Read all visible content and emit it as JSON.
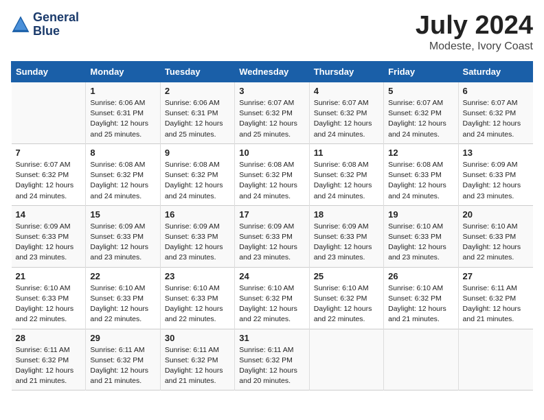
{
  "header": {
    "logo_line1": "General",
    "logo_line2": "Blue",
    "main_title": "July 2024",
    "subtitle": "Modeste, Ivory Coast"
  },
  "days_of_week": [
    "Sunday",
    "Monday",
    "Tuesday",
    "Wednesday",
    "Thursday",
    "Friday",
    "Saturday"
  ],
  "weeks": [
    [
      {
        "day": "",
        "sunrise": "",
        "sunset": "",
        "daylight": ""
      },
      {
        "day": "1",
        "sunrise": "Sunrise: 6:06 AM",
        "sunset": "Sunset: 6:31 PM",
        "daylight": "Daylight: 12 hours and 25 minutes."
      },
      {
        "day": "2",
        "sunrise": "Sunrise: 6:06 AM",
        "sunset": "Sunset: 6:31 PM",
        "daylight": "Daylight: 12 hours and 25 minutes."
      },
      {
        "day": "3",
        "sunrise": "Sunrise: 6:07 AM",
        "sunset": "Sunset: 6:32 PM",
        "daylight": "Daylight: 12 hours and 25 minutes."
      },
      {
        "day": "4",
        "sunrise": "Sunrise: 6:07 AM",
        "sunset": "Sunset: 6:32 PM",
        "daylight": "Daylight: 12 hours and 24 minutes."
      },
      {
        "day": "5",
        "sunrise": "Sunrise: 6:07 AM",
        "sunset": "Sunset: 6:32 PM",
        "daylight": "Daylight: 12 hours and 24 minutes."
      },
      {
        "day": "6",
        "sunrise": "Sunrise: 6:07 AM",
        "sunset": "Sunset: 6:32 PM",
        "daylight": "Daylight: 12 hours and 24 minutes."
      }
    ],
    [
      {
        "day": "7",
        "sunrise": "Sunrise: 6:07 AM",
        "sunset": "Sunset: 6:32 PM",
        "daylight": "Daylight: 12 hours and 24 minutes."
      },
      {
        "day": "8",
        "sunrise": "Sunrise: 6:08 AM",
        "sunset": "Sunset: 6:32 PM",
        "daylight": "Daylight: 12 hours and 24 minutes."
      },
      {
        "day": "9",
        "sunrise": "Sunrise: 6:08 AM",
        "sunset": "Sunset: 6:32 PM",
        "daylight": "Daylight: 12 hours and 24 minutes."
      },
      {
        "day": "10",
        "sunrise": "Sunrise: 6:08 AM",
        "sunset": "Sunset: 6:32 PM",
        "daylight": "Daylight: 12 hours and 24 minutes."
      },
      {
        "day": "11",
        "sunrise": "Sunrise: 6:08 AM",
        "sunset": "Sunset: 6:32 PM",
        "daylight": "Daylight: 12 hours and 24 minutes."
      },
      {
        "day": "12",
        "sunrise": "Sunrise: 6:08 AM",
        "sunset": "Sunset: 6:33 PM",
        "daylight": "Daylight: 12 hours and 24 minutes."
      },
      {
        "day": "13",
        "sunrise": "Sunrise: 6:09 AM",
        "sunset": "Sunset: 6:33 PM",
        "daylight": "Daylight: 12 hours and 23 minutes."
      }
    ],
    [
      {
        "day": "14",
        "sunrise": "Sunrise: 6:09 AM",
        "sunset": "Sunset: 6:33 PM",
        "daylight": "Daylight: 12 hours and 23 minutes."
      },
      {
        "day": "15",
        "sunrise": "Sunrise: 6:09 AM",
        "sunset": "Sunset: 6:33 PM",
        "daylight": "Daylight: 12 hours and 23 minutes."
      },
      {
        "day": "16",
        "sunrise": "Sunrise: 6:09 AM",
        "sunset": "Sunset: 6:33 PM",
        "daylight": "Daylight: 12 hours and 23 minutes."
      },
      {
        "day": "17",
        "sunrise": "Sunrise: 6:09 AM",
        "sunset": "Sunset: 6:33 PM",
        "daylight": "Daylight: 12 hours and 23 minutes."
      },
      {
        "day": "18",
        "sunrise": "Sunrise: 6:09 AM",
        "sunset": "Sunset: 6:33 PM",
        "daylight": "Daylight: 12 hours and 23 minutes."
      },
      {
        "day": "19",
        "sunrise": "Sunrise: 6:10 AM",
        "sunset": "Sunset: 6:33 PM",
        "daylight": "Daylight: 12 hours and 23 minutes."
      },
      {
        "day": "20",
        "sunrise": "Sunrise: 6:10 AM",
        "sunset": "Sunset: 6:33 PM",
        "daylight": "Daylight: 12 hours and 22 minutes."
      }
    ],
    [
      {
        "day": "21",
        "sunrise": "Sunrise: 6:10 AM",
        "sunset": "Sunset: 6:33 PM",
        "daylight": "Daylight: 12 hours and 22 minutes."
      },
      {
        "day": "22",
        "sunrise": "Sunrise: 6:10 AM",
        "sunset": "Sunset: 6:33 PM",
        "daylight": "Daylight: 12 hours and 22 minutes."
      },
      {
        "day": "23",
        "sunrise": "Sunrise: 6:10 AM",
        "sunset": "Sunset: 6:33 PM",
        "daylight": "Daylight: 12 hours and 22 minutes."
      },
      {
        "day": "24",
        "sunrise": "Sunrise: 6:10 AM",
        "sunset": "Sunset: 6:32 PM",
        "daylight": "Daylight: 12 hours and 22 minutes."
      },
      {
        "day": "25",
        "sunrise": "Sunrise: 6:10 AM",
        "sunset": "Sunset: 6:32 PM",
        "daylight": "Daylight: 12 hours and 22 minutes."
      },
      {
        "day": "26",
        "sunrise": "Sunrise: 6:10 AM",
        "sunset": "Sunset: 6:32 PM",
        "daylight": "Daylight: 12 hours and 21 minutes."
      },
      {
        "day": "27",
        "sunrise": "Sunrise: 6:11 AM",
        "sunset": "Sunset: 6:32 PM",
        "daylight": "Daylight: 12 hours and 21 minutes."
      }
    ],
    [
      {
        "day": "28",
        "sunrise": "Sunrise: 6:11 AM",
        "sunset": "Sunset: 6:32 PM",
        "daylight": "Daylight: 12 hours and 21 minutes."
      },
      {
        "day": "29",
        "sunrise": "Sunrise: 6:11 AM",
        "sunset": "Sunset: 6:32 PM",
        "daylight": "Daylight: 12 hours and 21 minutes."
      },
      {
        "day": "30",
        "sunrise": "Sunrise: 6:11 AM",
        "sunset": "Sunset: 6:32 PM",
        "daylight": "Daylight: 12 hours and 21 minutes."
      },
      {
        "day": "31",
        "sunrise": "Sunrise: 6:11 AM",
        "sunset": "Sunset: 6:32 PM",
        "daylight": "Daylight: 12 hours and 20 minutes."
      },
      {
        "day": "",
        "sunrise": "",
        "sunset": "",
        "daylight": ""
      },
      {
        "day": "",
        "sunrise": "",
        "sunset": "",
        "daylight": ""
      },
      {
        "day": "",
        "sunrise": "",
        "sunset": "",
        "daylight": ""
      }
    ]
  ]
}
